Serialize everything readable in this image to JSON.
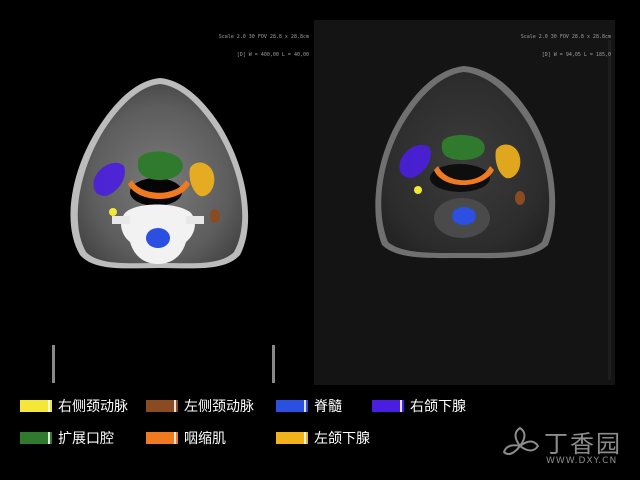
{
  "panels": {
    "ct": {
      "header_lines": [
        "Scale 2.0 30 FOV 28.8 x 28.8cm",
        "[D] W = 400,00 L = 40,00"
      ],
      "footer_lines": [
        "",
        "",
        ""
      ]
    },
    "mr": {
      "header_lines": [
        "Scale 2.0 30 FOV 28.8 x 28.8cm",
        "[D] W = 94,05 L = 185,0"
      ],
      "footer_lines": [
        "",
        "",
        ""
      ]
    }
  },
  "colors": {
    "right_carotid": "#f5e63a",
    "left_carotid": "#8a4a22",
    "spinal_cord": "#2b4fe0",
    "right_submandibular": "#4a1ee0",
    "dilated_oral_cavity": "#2f7a2c",
    "constrictor_muscle": "#f07a20",
    "left_submandibular": "#f2b21c"
  },
  "legend": [
    {
      "label": "右侧颈动脉",
      "color_key": "right_carotid"
    },
    {
      "label": "左侧颈动脉",
      "color_key": "left_carotid"
    },
    {
      "label": "脊髓",
      "color_key": "spinal_cord"
    },
    {
      "label": "右颌下腺",
      "color_key": "right_submandibular"
    },
    {
      "label": "扩展口腔",
      "color_key": "dilated_oral_cavity"
    },
    {
      "label": "咽缩肌",
      "color_key": "constrictor_muscle"
    },
    {
      "label": "左颌下腺",
      "color_key": "left_submandibular"
    }
  ],
  "watermark": {
    "brand": "丁香园",
    "url": "WWW.DXY.CN"
  }
}
